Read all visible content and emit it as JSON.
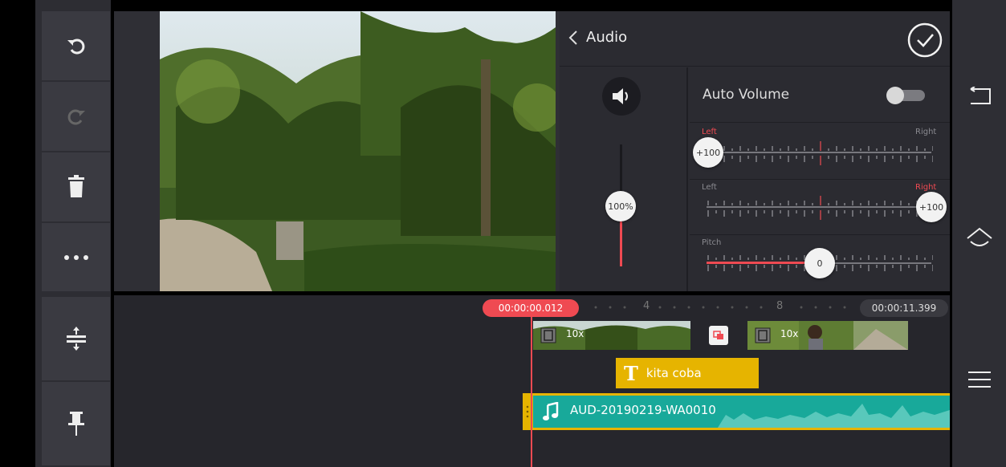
{
  "left_toolbar": {
    "items": [
      {
        "name": "undo-icon"
      },
      {
        "name": "redo-icon"
      },
      {
        "name": "trash-icon"
      },
      {
        "name": "more-icon"
      }
    ],
    "bottom_items": [
      {
        "name": "timeline-height-icon"
      },
      {
        "name": "pin-icon"
      }
    ]
  },
  "audio_panel": {
    "back_label": "Audio",
    "auto_volume_label": "Auto Volume",
    "auto_volume_on": false,
    "volume_value": "100%",
    "volume_level_percent": 100,
    "pan1": {
      "left_label": "Left",
      "right_label": "Right",
      "value": "+100",
      "active": "left"
    },
    "pan2": {
      "left_label": "Left",
      "right_label": "Right",
      "value": "+100",
      "active": "right"
    },
    "pitch": {
      "label": "Pitch",
      "value": "0"
    }
  },
  "timeline": {
    "playhead_time": "00:00:00.012",
    "end_time": "00:00:11.399",
    "ruler_marks": [
      "4",
      "8"
    ],
    "clip1_speed": "10x",
    "clip2_speed": "10x",
    "text_layer": "kita coba",
    "audio_clip_name": "AUD-20190219-WA0010"
  },
  "right_nav": {
    "items": [
      {
        "name": "back-nav-icon"
      },
      {
        "name": "home-nav-icon"
      },
      {
        "name": "menu-nav-icon"
      }
    ]
  },
  "colors": {
    "accent_red": "#ef4a52",
    "teal": "#18a99a",
    "gold": "#e6b400"
  }
}
